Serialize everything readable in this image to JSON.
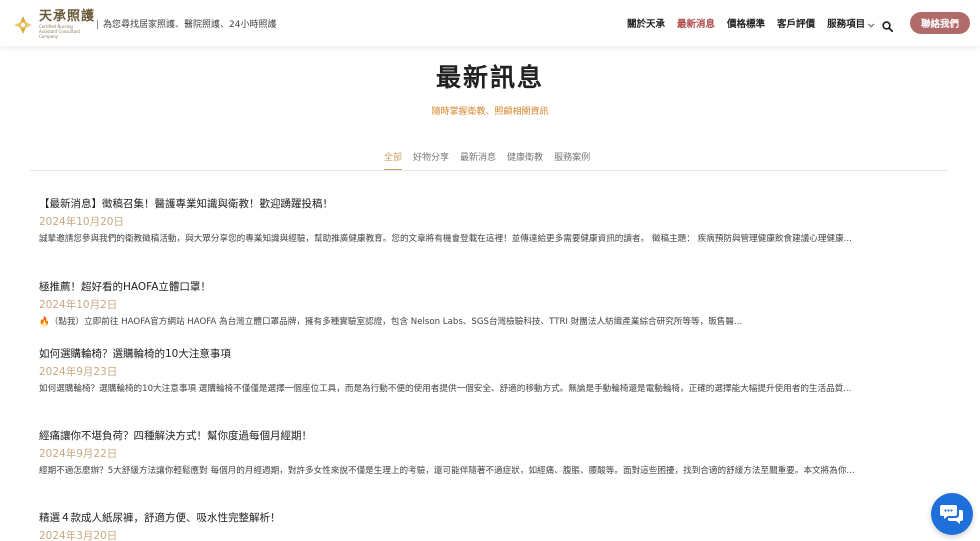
{
  "brand": {
    "name": "天承照護",
    "subtitle": "Certified Nursing Assistant Consultant Company",
    "tagline": "為您尋找居家照護、醫院照護、24小時照護",
    "colors": {
      "gold": "#c9a46a",
      "brand_red": "#b04a4a",
      "button": "#b06a6a",
      "accent_orange": "#d6862a"
    }
  },
  "nav": {
    "items": [
      {
        "label": "關於天承"
      },
      {
        "label": "最新消息"
      },
      {
        "label": "價格標準"
      },
      {
        "label": "客戶評價"
      },
      {
        "label": "服務項目"
      }
    ],
    "active": "最新消息",
    "search_icon": "search-icon",
    "contact_label": "聯絡我們"
  },
  "hero": {
    "title": "最新訊息",
    "subtitle": "隨時掌握衛教、照顧相關資訊"
  },
  "tabs": [
    "全部",
    "好物分享",
    "最新消息",
    "健康衛教",
    "服務案例"
  ],
  "active_tab": "全部",
  "posts": [
    {
      "title": "【最新消息】徵稿召集！醫護專業知識與衛教！歡迎踴躍投稿！",
      "date": "2024年10月20日",
      "excerpt": "誠摯邀請您參與我們的衛教徵稿活動，與大眾分享您的專業知識與經驗，幫助推廣健康教育。您的文章將有機會登載在這裡！並傳達給更多需要健康資訊的讀者。 徵稿主題： 疾病預防與管理健康飲食建議心理健康..."
    },
    {
      "title": "極推薦！超好看的HAOFA立體口罩！",
      "date": "2024年10月2日",
      "excerpt": "🔥（點我）立即前往 HAOFA官方網站 HAOFA 為台灣立體口罩品牌，擁有多種實驗室認證，包含 Nelson Labs、SGS台灣檢驗科技、TTRI 財團法人紡織產業綜合研究所等等，販售醫..."
    },
    {
      "title": "如何選購輪椅？選購輪椅的10大注意事項",
      "date": "2024年9月23日",
      "excerpt": "如何選購輪椅？選購輪椅的10大注意事項 選購輪椅不僅僅是選擇一個座位工具，而是為行動不便的使用者提供一個安全、舒適的移動方式。無論是手動輪椅還是電動輪椅，正確的選擇能大幅提升使用者的生活品質..."
    },
    {
      "title": "經痛讓你不堪負荷？四種解決方式！幫你度過每個月經期！",
      "date": "2024年9月22日",
      "excerpt": "經期不適怎麼辦？5大舒緩方法讓你輕鬆應對 每個月的月經週期，對許多女性來說不僅是生理上的考驗，還可能伴隨著不適症狀，如經痛、腹脹、腰酸等。面對這些困擾，找到合適的舒緩方法至關重要。本文將為你..."
    },
    {
      "title": "精選４款成人紙尿褲，舒適方便、吸水性完整解析！",
      "date": "2024年3月20日",
      "excerpt": ""
    }
  ],
  "chat_icon": "chat-bubbles-icon"
}
